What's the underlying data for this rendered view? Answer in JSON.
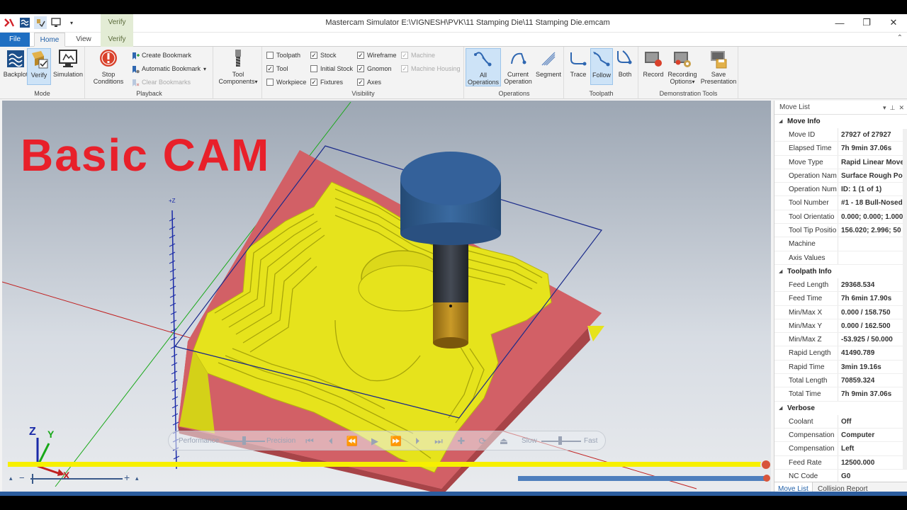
{
  "title_bar": {
    "title": "Mastercam Simulator  E:\\VIGNESH\\PVK\\11 Stamping Die\\11 Stamping Die.emcam",
    "context_tab_group": "Verify"
  },
  "tabs": [
    {
      "label": "File"
    },
    {
      "label": "Home"
    },
    {
      "label": "View"
    },
    {
      "label": "Verify"
    }
  ],
  "ribbon": {
    "mode": {
      "label": "Mode",
      "backplot": "Backplot",
      "verify": "Verify",
      "simulation": "Simulation"
    },
    "playback": {
      "label": "Playback",
      "stop_conditions": "Stop\nConditions",
      "create_bookmark": "Create Bookmark",
      "automatic_bookmark": "Automatic Bookmark",
      "clear_bookmarks": "Clear Bookmarks"
    },
    "tool_components": "Tool\nComponents",
    "visibility": {
      "label": "Visibility",
      "items": [
        {
          "label": "Toolpath",
          "checked": false,
          "enabled": true
        },
        {
          "label": "Tool",
          "checked": true,
          "enabled": true
        },
        {
          "label": "Workpiece",
          "checked": false,
          "enabled": true
        },
        {
          "label": "Stock",
          "checked": true,
          "enabled": true
        },
        {
          "label": "Initial Stock",
          "checked": false,
          "enabled": true
        },
        {
          "label": "Fixtures",
          "checked": true,
          "enabled": true
        },
        {
          "label": "Wireframe",
          "checked": true,
          "enabled": true
        },
        {
          "label": "Gnomon",
          "checked": true,
          "enabled": true
        },
        {
          "label": "Axes",
          "checked": true,
          "enabled": true
        },
        {
          "label": "Machine",
          "checked": true,
          "enabled": false
        },
        {
          "label": "Machine Housing",
          "checked": true,
          "enabled": false
        }
      ]
    },
    "operations": {
      "label": "Operations",
      "all": "All\nOperations",
      "current": "Current\nOperation",
      "segment": "Segment"
    },
    "toolpath": {
      "label": "Toolpath",
      "trace": "Trace",
      "follow": "Follow",
      "both": "Both"
    },
    "demo": {
      "label": "Demonstration Tools",
      "record": "Record",
      "recording_options": "Recording\nOptions",
      "save_presentation": "Save\nPresentation"
    }
  },
  "viewport": {
    "overlay_title": "Basic CAM",
    "axis_label_z": "+Z",
    "gnomon": {
      "x": "X",
      "y": "Y",
      "z": "Z"
    },
    "playbar": {
      "performance": "Performance",
      "precision": "Precision",
      "slow": "Slow",
      "fast": "Fast"
    },
    "stock_color": "#c8585c",
    "cut_color": "#e8e614",
    "tool_holder_color": "#2f5a8a",
    "tool_shank_color": "#2b2f36",
    "tool_tip_color": "#b88a1a"
  },
  "move_list": {
    "title": "Move List",
    "sections": [
      {
        "name": "Move Info",
        "rows": [
          {
            "k": "Move ID",
            "v": "27927 of 27927"
          },
          {
            "k": "Elapsed Time",
            "v": "7h 9min 37.06s"
          },
          {
            "k": "Move Type",
            "v": "Rapid Linear Move"
          },
          {
            "k": "Operation Nam",
            "v": "Surface Rough Po"
          },
          {
            "k": "Operation Num",
            "v": "ID: 1 (1 of 1)"
          },
          {
            "k": "Tool Number",
            "v": "#1 - 18 Bull-Nosed"
          },
          {
            "k": "Tool Orientatio",
            "v": "0.000; 0.000; 1.000"
          },
          {
            "k": "Tool Tip Positio",
            "v": "156.020; 2.996; 50"
          },
          {
            "k": "Machine",
            "v": ""
          },
          {
            "k": "Axis Values",
            "v": ""
          }
        ]
      },
      {
        "name": "Toolpath Info",
        "rows": [
          {
            "k": "Feed Length",
            "v": "29368.534"
          },
          {
            "k": "Feed Time",
            "v": "7h 6min 17.90s"
          },
          {
            "k": "Min/Max X",
            "v": "0.000 / 158.750"
          },
          {
            "k": "Min/Max Y",
            "v": "0.000 / 162.500"
          },
          {
            "k": "Min/Max Z",
            "v": "-53.925 / 50.000"
          },
          {
            "k": "Rapid Length",
            "v": "41490.789"
          },
          {
            "k": "Rapid Time",
            "v": "3min 19.16s"
          },
          {
            "k": "Total Length",
            "v": "70859.324"
          },
          {
            "k": "Total Time",
            "v": "7h 9min 37.06s"
          }
        ]
      },
      {
        "name": "Verbose",
        "rows": [
          {
            "k": "Coolant",
            "v": "Off"
          },
          {
            "k": "Compensation",
            "v": "Computer"
          },
          {
            "k": "Compensation",
            "v": "Left"
          },
          {
            "k": "Feed Rate",
            "v": "12500.000"
          },
          {
            "k": "NC Code",
            "v": "G0"
          }
        ]
      }
    ],
    "tabs": [
      "Move List",
      "Collision Report"
    ]
  }
}
